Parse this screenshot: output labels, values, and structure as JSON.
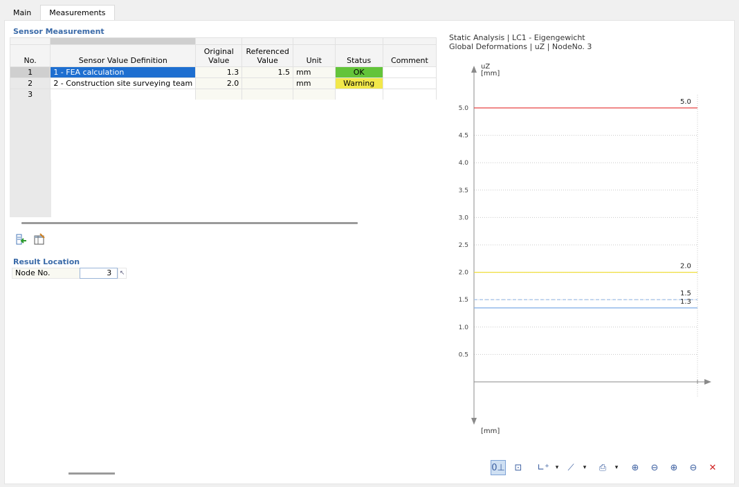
{
  "tabs": {
    "main": "Main",
    "measurements": "Measurements"
  },
  "sensor": {
    "title": "Sensor Measurement",
    "headers": {
      "no": "No.",
      "definition": "Sensor Value Definition",
      "original_1": "Original",
      "original_2": "Value",
      "referenced_1": "Referenced",
      "referenced_2": "Value",
      "unit": "Unit",
      "status": "Status",
      "comment": "Comment"
    },
    "rows": [
      {
        "no": "1",
        "definition": "1 - FEA calculation",
        "original": "1.3",
        "referenced": "1.5",
        "unit": "mm",
        "status": "OK",
        "comment": ""
      },
      {
        "no": "2",
        "definition": "2 - Construction site surveying team",
        "original": "2.0",
        "referenced": "",
        "unit": "mm",
        "status": "Warning",
        "comment": ""
      },
      {
        "no": "3",
        "definition": "",
        "original": "",
        "referenced": "",
        "unit": "",
        "status": "",
        "comment": ""
      }
    ]
  },
  "toolbar1": {
    "icons": [
      "import-icon",
      "edit-table-icon"
    ]
  },
  "result_location": {
    "title": "Result Location",
    "node_label": "Node No.",
    "node_value": "3"
  },
  "chart": {
    "title_line1": "Static Analysis | LC1 - Eigengewicht",
    "title_line2": "Global Deformations | uZ | NodeNo. 3",
    "colors": {
      "red": "#e84040",
      "yellow": "#f0de3a",
      "blue": "#86b2e8",
      "dashed": "#a8c4ea",
      "axis": "#888888"
    }
  },
  "chart_data": {
    "type": "line",
    "ylabel": "uZ",
    "yunit": "[mm]",
    "xunit": "[mm]",
    "ylim": [
      0,
      5.0
    ],
    "yticks": [
      "5.0",
      "4.5",
      "4.0",
      "3.5",
      "3.0",
      "2.5",
      "2.0",
      "1.5",
      "1.0",
      "0.5"
    ],
    "grid": true,
    "series": [
      {
        "label": "5.0",
        "value": 5.0,
        "color": "#e84040",
        "style": "solid"
      },
      {
        "label": "2.0",
        "value": 2.0,
        "color": "#f0de3a",
        "style": "solid"
      },
      {
        "label": "1.5",
        "value": 1.5,
        "color": "#a8c4ea",
        "style": "dashed"
      },
      {
        "label": "1.3",
        "value": 1.35,
        "color": "#86b2e8",
        "style": "solid"
      }
    ]
  },
  "toolbar2": {
    "icons": [
      "axis-origin-icon",
      "frame-icon",
      "axis-add-icon",
      "chevron-down-icon",
      "line-style-icon",
      "chevron-down-icon",
      "print-icon",
      "chevron-down-icon",
      "zoom-in-icon",
      "zoom-out-icon",
      "zoom-in-y-icon",
      "zoom-out-y-icon",
      "reset-zoom-icon"
    ]
  }
}
